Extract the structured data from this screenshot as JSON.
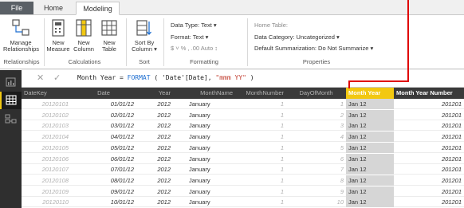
{
  "tabs": {
    "file": "File",
    "home": "Home",
    "modeling": "Modeling"
  },
  "ribbon": {
    "manage_relationships": [
      "Manage",
      "Relationships"
    ],
    "new_measure": [
      "New",
      "Measure"
    ],
    "new_column": [
      "New",
      "Column"
    ],
    "new_table": [
      "New",
      "Table"
    ],
    "sort_by_column": [
      "Sort By",
      "Column ▾"
    ],
    "data_type": "Data Type: Text ▾",
    "format": "Format: Text ▾",
    "currency": "$ ˅  %  ,  .00  Auto ↕",
    "home_table": "Home Table:",
    "data_category": "Data Category: Uncategorized ▾",
    "default_summarization": "Default Summarization: Do Not Summarize ▾",
    "groups": {
      "relationships": "Relationships",
      "calculations": "Calculations",
      "sort": "Sort",
      "formatting": "Formatting",
      "properties": "Properties"
    }
  },
  "formula": {
    "lhs": "Month Year = ",
    "func": "FORMAT",
    "args": " ( 'Date'[Date], ",
    "fmt": "\"mmm YY\"",
    "close": " )"
  },
  "grid": {
    "columns": [
      "DateKey",
      "Date",
      "Year",
      "MonthName",
      "MonthNumber",
      "DayOfMonth",
      "Month Year",
      "Month Year Number"
    ],
    "selected_column": "Month Year",
    "rows": [
      [
        "20120101",
        "01/01/12",
        "2012",
        "January",
        "1",
        "1",
        "Jan 12",
        "201201"
      ],
      [
        "20120102",
        "02/01/12",
        "2012",
        "January",
        "1",
        "2",
        "Jan 12",
        "201201"
      ],
      [
        "20120103",
        "03/01/12",
        "2012",
        "January",
        "1",
        "3",
        "Jan 12",
        "201201"
      ],
      [
        "20120104",
        "04/01/12",
        "2012",
        "January",
        "1",
        "4",
        "Jan 12",
        "201201"
      ],
      [
        "20120105",
        "05/01/12",
        "2012",
        "January",
        "1",
        "5",
        "Jan 12",
        "201201"
      ],
      [
        "20120106",
        "06/01/12",
        "2012",
        "January",
        "1",
        "6",
        "Jan 12",
        "201201"
      ],
      [
        "20120107",
        "07/01/12",
        "2012",
        "January",
        "1",
        "7",
        "Jan 12",
        "201201"
      ],
      [
        "20120108",
        "08/01/12",
        "2012",
        "January",
        "1",
        "8",
        "Jan 12",
        "201201"
      ],
      [
        "20120109",
        "09/01/12",
        "2012",
        "January",
        "1",
        "9",
        "Jan 12",
        "201201"
      ],
      [
        "20120110",
        "10/01/12",
        "2012",
        "January",
        "1",
        "10",
        "Jan 12",
        "201201"
      ]
    ]
  },
  "colors": {
    "accent": "#f2c811",
    "callout": "#e00000",
    "header": "#3a3a3a",
    "nav": "#2f2f2f"
  }
}
